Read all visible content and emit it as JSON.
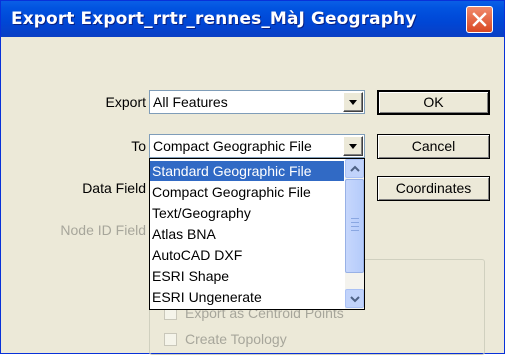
{
  "window": {
    "title": "Export Export_rrtr_rennes_MàJ Geography"
  },
  "form": {
    "export_label": "Export",
    "export_value": "All Features",
    "to_label": "To",
    "to_value": "Compact Geographic File",
    "data_field_label": "Data Field",
    "node_id_label": "Node ID Field"
  },
  "buttons": {
    "ok": "OK",
    "cancel": "Cancel",
    "coordinates": "Coordinates"
  },
  "dropdown": {
    "items": [
      "Standard Geographic File",
      "Compact Geographic File",
      "Text/Geography",
      "Atlas BNA",
      "AutoCAD DXF",
      "ESRI Shape",
      "ESRI Ungenerate"
    ],
    "selected_index": 0
  },
  "options": {
    "centroid": "Export as Centroid Points",
    "topology": "Create Topology"
  },
  "colors": {
    "titlebar": "#0046d5",
    "selection": "#316ac5",
    "window_bg": "#ece9d8"
  },
  "icons": {
    "close": "close-icon",
    "dropdown_arrow": "chevron-down-icon"
  }
}
